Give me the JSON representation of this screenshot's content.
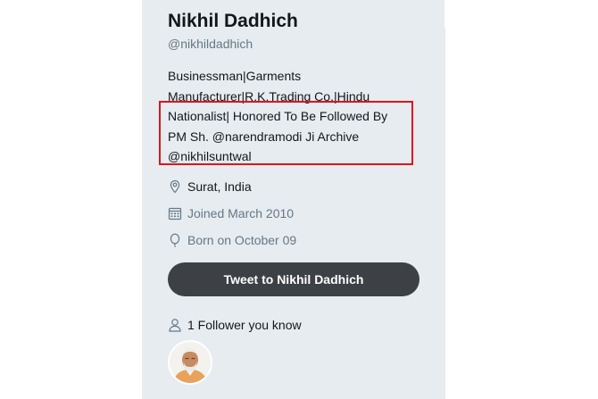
{
  "profile": {
    "name": "Nikhil Dadhich",
    "handle": "@nikhildadhich",
    "bio_lines": [
      "Businessman|Garments",
      "Manufacturer|R.K.Trading Co.|Hindu",
      "Nationalist| Honored To Be Followed By",
      "PM Sh. @narendramodi Ji Archive",
      "@nikhilsuntwal"
    ],
    "location": "Surat, India",
    "joined": "Joined March 2010",
    "born": "Born on October 09",
    "location_icon": "location-pin-icon",
    "joined_icon": "calendar-icon",
    "born_icon": "balloon-icon"
  },
  "actions": {
    "tweet_button_label": "Tweet to Nikhil Dadhich"
  },
  "followers_you_know": {
    "label": "1 Follower you know",
    "icon": "person-icon"
  },
  "colors": {
    "panel_bg": "#e6ecf0",
    "highlight_border": "#e0141b",
    "button_bg": "#3d4145",
    "secondary_text": "#657786",
    "primary_text": "#14171a"
  }
}
